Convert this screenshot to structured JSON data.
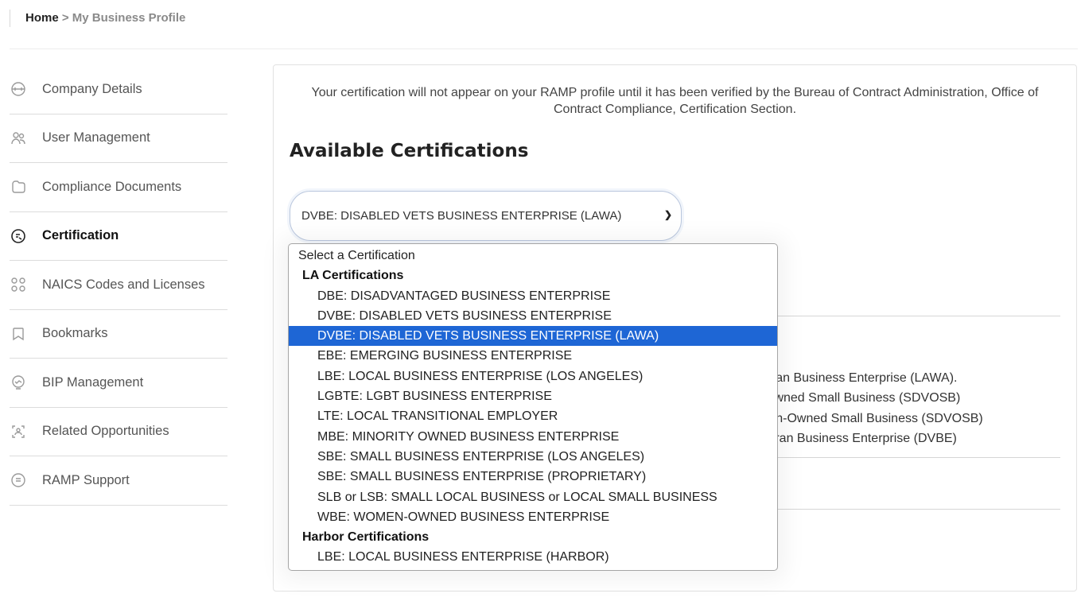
{
  "breadcrumb": {
    "home": "Home",
    "separator": ">",
    "current": "My Business Profile"
  },
  "sidebar": {
    "items": [
      {
        "label": "Company Details",
        "icon": "building-icon"
      },
      {
        "label": "User Management",
        "icon": "users-icon"
      },
      {
        "label": "Compliance Documents",
        "icon": "folder-icon"
      },
      {
        "label": "Certification",
        "icon": "certificate-icon",
        "active": true
      },
      {
        "label": "NAICS Codes and Licenses",
        "icon": "grid-icon"
      },
      {
        "label": "Bookmarks",
        "icon": "bookmark-icon"
      },
      {
        "label": "BIP Management",
        "icon": "monitor-icon"
      },
      {
        "label": "Related Opportunities",
        "icon": "opportunities-icon"
      },
      {
        "label": "RAMP Support",
        "icon": "support-icon"
      }
    ]
  },
  "main": {
    "notice": "Your certification will not appear on your RAMP profile until it has been verified by the Bureau of Contract Administration, Office of Contract Compliance, Certification Section.",
    "section_title": "Available Certifications",
    "select": {
      "value": "DVBE: DISABLED VETS BUSINESS ENTERPRISE (LAWA)"
    },
    "background_lines": [
      "eran Business Enterprise (LAWA).",
      "Owned Small Business (SDVOSB)",
      "ran-Owned Small Business (SDVOSB)",
      "teran Business Enterprise (DVBE)"
    ]
  },
  "dropdown": {
    "placeholder": "Select a Certification",
    "groups": [
      {
        "label": "LA Certifications",
        "options": [
          "DBE: DISADVANTAGED BUSINESS ENTERPRISE",
          "DVBE: DISABLED VETS BUSINESS ENTERPRISE",
          "DVBE: DISABLED VETS BUSINESS ENTERPRISE (LAWA)",
          "EBE: EMERGING BUSINESS ENTERPRISE",
          "LBE: LOCAL BUSINESS ENTERPRISE (LOS ANGELES)",
          "LGBTE: LGBT BUSINESS ENTERPRISE",
          "LTE: LOCAL TRANSITIONAL EMPLOYER",
          "MBE: MINORITY OWNED BUSINESS ENTERPRISE",
          "SBE: SMALL BUSINESS ENTERPRISE (LOS ANGELES)",
          "SBE: SMALL BUSINESS ENTERPRISE (PROPRIETARY)",
          "SLB or LSB: SMALL LOCAL BUSINESS or LOCAL SMALL BUSINESS",
          "WBE: WOMEN-OWNED BUSINESS ENTERPRISE"
        ]
      },
      {
        "label": "Harbor Certifications",
        "options": [
          "LBE: LOCAL BUSINESS ENTERPRISE (HARBOR)"
        ]
      }
    ],
    "selected_index": 2
  },
  "colors": {
    "highlight": "#1e66d5",
    "active_text": "#111111",
    "muted": "#8a8a8a"
  }
}
